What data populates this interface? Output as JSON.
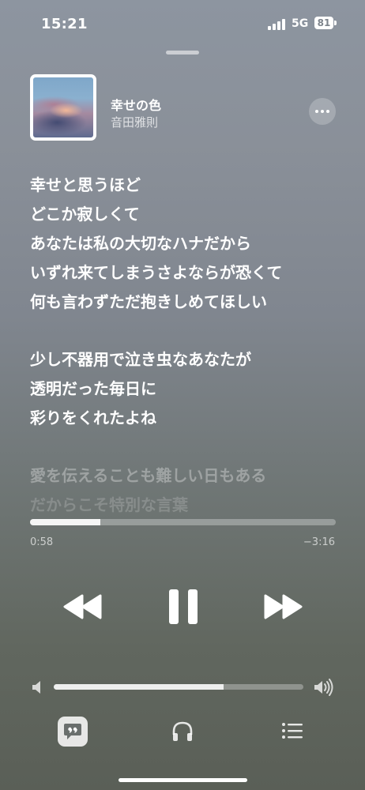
{
  "status_bar": {
    "time": "15:21",
    "network": "5G",
    "battery": "81"
  },
  "track": {
    "title": "幸せの色",
    "artist": "音田雅則"
  },
  "lyrics": {
    "active": [
      "幸せと思うほど",
      "どこか寂しくて",
      "あなたは私の大切なハナだから",
      "いずれ来てしまうさよならが恐くて",
      "何も言わずただ抱きしめてほしい",
      "少し不器用で泣き虫なあなたが",
      "透明だった毎日に",
      "彩りをくれたよね"
    ],
    "upcoming": [
      "愛を伝えることも難しい日もある",
      "だからこそ特別な言葉"
    ]
  },
  "playback": {
    "elapsed": "0:58",
    "remaining": "−3:16",
    "progress": 0.23
  },
  "volume": {
    "level": 0.68
  },
  "icons": {
    "more": "more-horizontal-icon",
    "rewind": "backward-icon",
    "pause": "pause-icon",
    "forward": "forward-icon",
    "volume_low": "speaker-low-icon",
    "volume_high": "speaker-high-icon",
    "lyrics": "lyrics-quote-icon",
    "output": "headphones-icon",
    "queue": "list-icon"
  }
}
